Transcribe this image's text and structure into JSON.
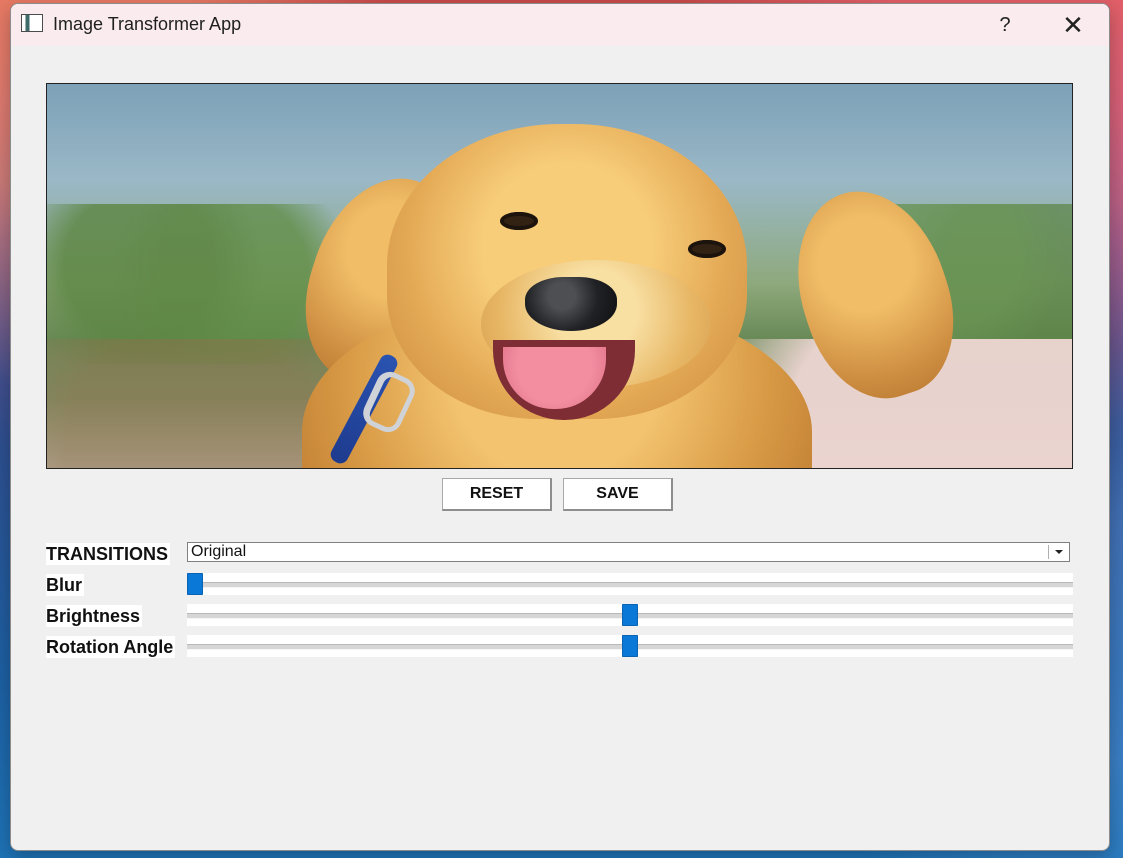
{
  "window": {
    "title": "Image Transformer App",
    "help_symbol": "?",
    "close_symbol": "✕"
  },
  "buttons": {
    "reset": "RESET",
    "save": "SAVE"
  },
  "controls": {
    "transitions_label": "TRANSITIONS",
    "transition_value": "Original",
    "blur_label": "Blur",
    "brightness_label": "Brightness",
    "rotation_label": "Rotation Angle"
  },
  "slider_levels": {
    "blur": 0,
    "brightness": 0.5,
    "rotation": 0.5
  },
  "colors": {
    "accent": "#0a78d7"
  },
  "icons": {
    "app": "app-icon",
    "help": "help-icon",
    "close": "close-icon",
    "dropdown": "chevron-down-icon"
  }
}
